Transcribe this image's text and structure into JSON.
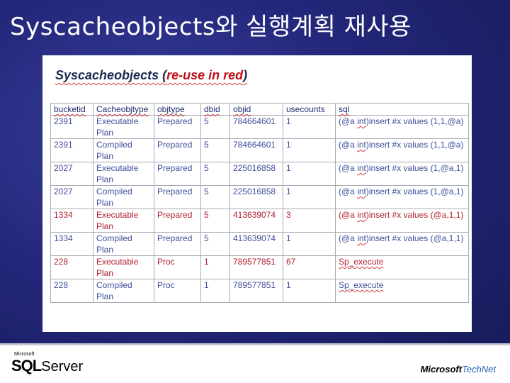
{
  "slide": {
    "title": "Syscacheobjects와 실행계획 재사용"
  },
  "panel": {
    "heading_main": "Syscacheobjects",
    "heading_paren_open": " (",
    "heading_red": "re-use in red",
    "heading_paren_close": ")"
  },
  "table": {
    "headers": [
      "bucketid",
      "Cacheobjtype",
      "objtype",
      "dbid",
      "objid",
      "usecounts",
      "sql"
    ],
    "rows": [
      {
        "bucketid": "2391",
        "cacheobjtype_1": "Executable",
        "cacheobjtype_2": "Plan",
        "objtype": "Prepared",
        "dbid": "5",
        "objid": "784664601",
        "usecounts": "1",
        "sql_part1": "(@a ",
        "sql_int": "int",
        "sql_part2": ")insert #x values (1,1,@a)",
        "highlight": false
      },
      {
        "bucketid": "2391",
        "cacheobjtype_1": "Compiled",
        "cacheobjtype_2": "Plan",
        "objtype": "Prepared",
        "dbid": "5",
        "objid": "784664601",
        "usecounts": "1",
        "sql_part1": "(@a ",
        "sql_int": "int",
        "sql_part2": ")insert #x values (1,1,@a)",
        "highlight": false
      },
      {
        "bucketid": "2027",
        "cacheobjtype_1": "Executable",
        "cacheobjtype_2": "Plan",
        "objtype": "Prepared",
        "dbid": "5",
        "objid": "225016858",
        "usecounts": "1",
        "sql_part1": "(@a ",
        "sql_int": "int",
        "sql_part2": ")insert #x values (1,@a,1)",
        "highlight": false
      },
      {
        "bucketid": "2027",
        "cacheobjtype_1": "Compiled",
        "cacheobjtype_2": "Plan",
        "objtype": "Prepared",
        "dbid": "5",
        "objid": "225016858",
        "usecounts": "1",
        "sql_part1": "(@a ",
        "sql_int": "int",
        "sql_part2": ")insert #x values (1,@a,1)",
        "highlight": false
      },
      {
        "bucketid": "1334",
        "cacheobjtype_1": "Executable",
        "cacheobjtype_2": "Plan",
        "objtype": "Prepared",
        "dbid": "5",
        "objid": "413639074",
        "usecounts": "3",
        "sql_part1": "(@a ",
        "sql_int": "int",
        "sql_part2": ")insert #x values (@a,1,1)",
        "highlight": true
      },
      {
        "bucketid": "1334",
        "cacheobjtype_1": "Compiled",
        "cacheobjtype_2": "Plan",
        "objtype": "Prepared",
        "dbid": "5",
        "objid": "413639074",
        "usecounts": "1",
        "sql_part1": "(@a ",
        "sql_int": "int",
        "sql_part2": ")insert #x values (@a,1,1)",
        "highlight": false
      },
      {
        "bucketid": "228",
        "cacheobjtype_1": "Executable",
        "cacheobjtype_2": "Plan",
        "objtype": "Proc",
        "dbid": "1",
        "objid": "789577851",
        "usecounts": "67",
        "sql_part1": "Sp_execute",
        "sql_int": "",
        "sql_part2": "",
        "highlight": true
      },
      {
        "bucketid": "228",
        "cacheobjtype_1": "Compiled",
        "cacheobjtype_2": "Plan",
        "objtype": "Proc",
        "dbid": "1",
        "objid": "789577851",
        "usecounts": "1",
        "sql_part1": "Sp_execute",
        "sql_int": "",
        "sql_part2": "",
        "highlight": false
      }
    ]
  },
  "footer": {
    "sql_microsoft": "Microsoft",
    "sql_sql": "SQL",
    "sql_server": "Server",
    "technet_microsoft": "Microsoft",
    "technet_technet": "TechNet"
  },
  "colors": {
    "background": "#23277a",
    "reuse_red": "#c0101a",
    "cell_text": "#3f4f9a"
  }
}
